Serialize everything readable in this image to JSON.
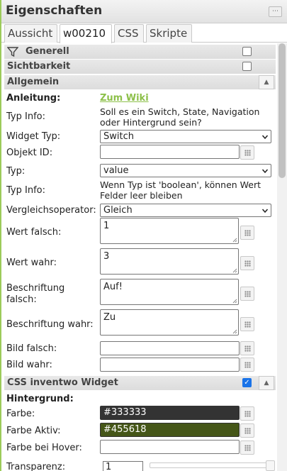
{
  "header": {
    "title": "Eigenschaften",
    "menu_icon": "menu-icon"
  },
  "tabs": [
    {
      "label": "Aussicht"
    },
    {
      "label": "w00210"
    },
    {
      "label": "CSS"
    },
    {
      "label": "Skripte"
    }
  ],
  "sections": {
    "generell": {
      "label": "Generell",
      "checked": false
    },
    "sichtbarkeit": {
      "label": "Sichtbarkeit",
      "checked": false
    },
    "allgemein": {
      "label": "Allgemein"
    },
    "css_inventwo": {
      "label": "CSS inventwo Widget",
      "checked": true
    }
  },
  "allgemein": {
    "anleitung_label": "Anleitung:",
    "anleitung_link": "Zum Wiki",
    "typinfo1_label": "Typ Info:",
    "typinfo1_text": "Soll es ein Switch, State, Navigation oder Hintergrund sein?",
    "widget_typ_label": "Widget Typ:",
    "widget_typ_value": "Switch",
    "objekt_id_label": "Objekt ID:",
    "objekt_id_value": "",
    "typ_label": "Typ:",
    "typ_value": "value",
    "typinfo2_label": "Typ Info:",
    "typinfo2_text": "Wenn Typ ist 'boolean', können Wert Felder leer bleiben",
    "vergleich_label": "Vergleichsoperator:",
    "vergleich_value": "Gleich",
    "wert_falsch_label": "Wert falsch:",
    "wert_falsch_value": "1",
    "wert_wahr_label": "Wert wahr:",
    "wert_wahr_value": "3",
    "beschriftung_falsch_label_1": "Beschriftung",
    "beschriftung_falsch_label_2": "falsch:",
    "beschriftung_falsch_value": "Auf!",
    "beschriftung_wahr_label": "Beschriftung wahr:",
    "beschriftung_wahr_value": "Zu",
    "bild_falsch_label": "Bild falsch:",
    "bild_wahr_label": "Bild wahr:"
  },
  "css_widget": {
    "hintergrund_label": "Hintergrund:",
    "farbe_label": "Farbe:",
    "farbe_value": "#333333",
    "farbe_aktiv_label": "Farbe Aktiv:",
    "farbe_aktiv_value": "#455618",
    "farbe_hover_label": "Farbe bei Hover:",
    "farbe_hover_value": "",
    "transparenz_label": "Transparenz:",
    "transparenz_value": "1",
    "transparenz_slider_fraction": 1.0
  },
  "colors": {
    "accent_green": "#8dc04a",
    "panel_border": "#9ccb5a",
    "checkbox_on": "#1a73e8"
  }
}
